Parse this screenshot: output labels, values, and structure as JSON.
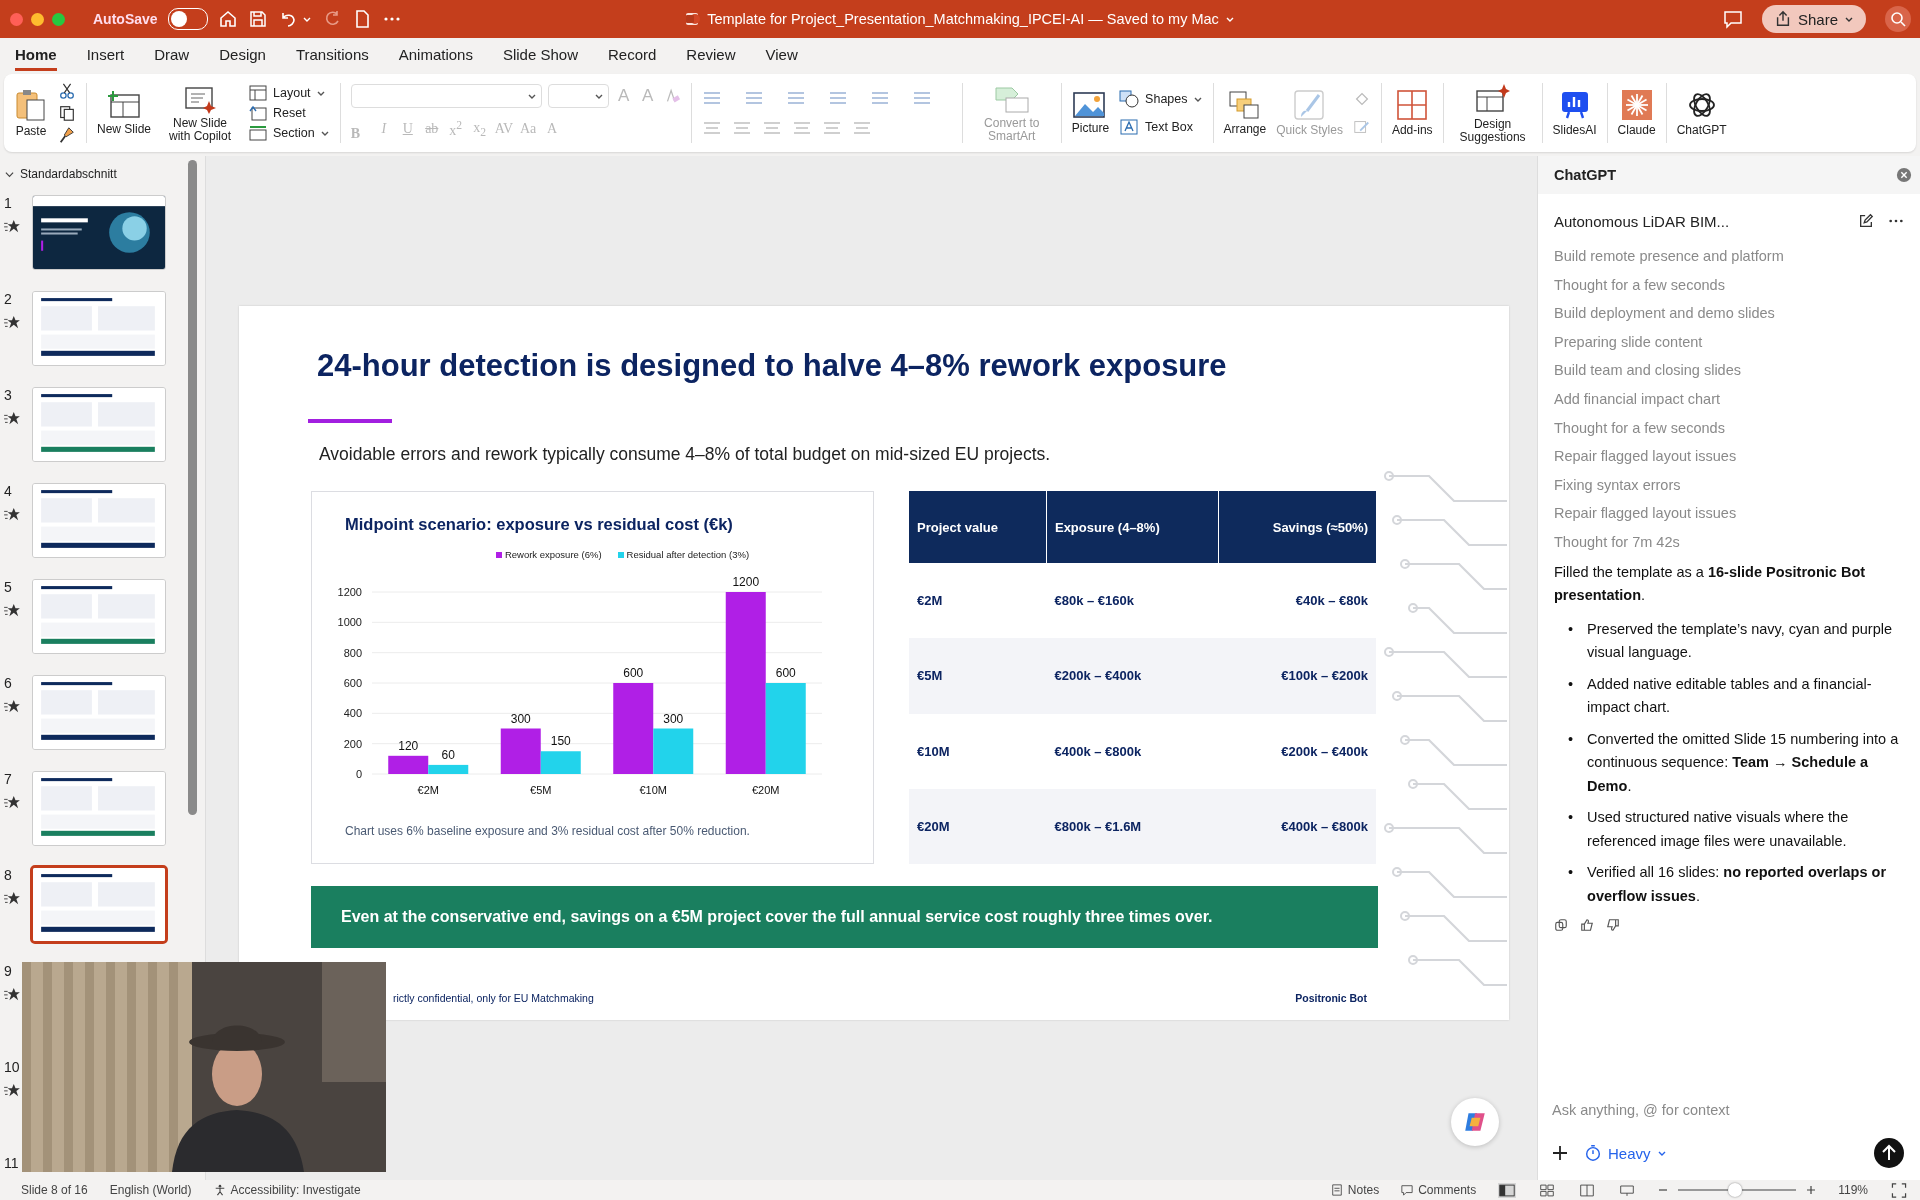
{
  "title_bar": {
    "autosave_label": "AutoSave",
    "autosave_on": false,
    "document_title": "Template for Project_Presentation_Matchmaking_IPCEI-AI — Saved to my Mac",
    "share_label": "Share"
  },
  "ribbon_tabs": [
    {
      "label": "Home",
      "selected": true
    },
    {
      "label": "Insert",
      "selected": false
    },
    {
      "label": "Draw",
      "selected": false
    },
    {
      "label": "Design",
      "selected": false
    },
    {
      "label": "Transitions",
      "selected": false
    },
    {
      "label": "Animations",
      "selected": false
    },
    {
      "label": "Slide Show",
      "selected": false
    },
    {
      "label": "Record",
      "selected": false
    },
    {
      "label": "Review",
      "selected": false
    },
    {
      "label": "View",
      "selected": false
    }
  ],
  "ribbon": {
    "paste": "Paste",
    "new_slide": "New Slide",
    "new_slide_copilot": "New Slide with Copilot",
    "layout": "Layout",
    "reset": "Reset",
    "section": "Section",
    "font_grow": [
      {
        "label": "A",
        "disabled": true
      },
      {
        "label": "A",
        "disabled": true
      }
    ],
    "font_format": [
      {
        "label": "B",
        "kind": "bold",
        "disabled": true
      },
      {
        "label": "I",
        "kind": "italic",
        "disabled": true
      },
      {
        "label": "U",
        "kind": "underline",
        "disabled": true
      },
      {
        "label": "ab",
        "kind": "strike",
        "disabled": true
      },
      {
        "label": "x$^{2}$",
        "kind": "plain",
        "disabled": true
      },
      {
        "label": "x$_{2}$",
        "kind": "plain",
        "disabled": true
      },
      {
        "label": "AV",
        "kind": "plain",
        "disabled": true
      },
      {
        "label": "Aa",
        "kind": "plain",
        "disabled": true
      },
      {
        "label": "A",
        "kind": "plain",
        "disabled": true
      }
    ],
    "convert_smartart": {
      "label": "Convert to SmartArt",
      "disabled": true
    },
    "picture": "Picture",
    "shapes": "Shapes",
    "text_box": "Text Box",
    "arrange": "Arrange",
    "quick_styles": {
      "label": "Quick Styles",
      "disabled": true
    },
    "add_ins": "Add-ins",
    "design_suggestions": "Design Suggestions",
    "slidesai": "SlidesAI",
    "claude": "Claude",
    "chatgpt": "ChatGPT"
  },
  "slide_panel": {
    "section_label": "Standardabschnitt",
    "slides": [
      {
        "number": "1",
        "selected": false,
        "kind": "dark"
      },
      {
        "number": "2",
        "selected": false,
        "kind": "light"
      },
      {
        "number": "3",
        "selected": false,
        "kind": "light"
      },
      {
        "number": "4",
        "selected": false,
        "kind": "light"
      },
      {
        "number": "5",
        "selected": false,
        "kind": "light"
      },
      {
        "number": "6",
        "selected": false,
        "kind": "light"
      },
      {
        "number": "7",
        "selected": false,
        "kind": "light"
      },
      {
        "number": "8",
        "selected": true,
        "kind": "light"
      }
    ],
    "covered_slides": [
      {
        "number": "9",
        "kind": "number_and_star"
      },
      {
        "number": "10",
        "kind": "number_and_star"
      },
      {
        "number": "11",
        "kind": "number_only"
      }
    ]
  },
  "slide": {
    "title": "24-hour detection is designed to halve 4–8% rework exposure",
    "subtitle": "Avoidable errors and rework typically consume 4–8% of total budget on mid-sized EU projects.",
    "chart_data": {
      "type": "bar",
      "title": "Midpoint scenario: exposure vs residual cost (€k)",
      "categories": [
        "€2M",
        "€5M",
        "€10M",
        "€20M"
      ],
      "series": [
        {
          "name": "Rework exposure (6%)",
          "color": "#b01fe6",
          "values": [
            120,
            300,
            600,
            1200
          ]
        },
        {
          "name": "Residual after detection (3%)",
          "color": "#22d3eb",
          "values": [
            60,
            150,
            300,
            600
          ]
        }
      ],
      "ylim": [
        0,
        1200
      ],
      "yticks": [
        0,
        200,
        400,
        600,
        800,
        1000,
        1200
      ],
      "grid": true,
      "data_labels": true
    },
    "chart_note": "Chart uses 6% baseline exposure and 3% residual cost after 50% reduction.",
    "table": {
      "columns": [
        "Project value",
        "Exposure (4–8%)",
        "Savings (≈50%)"
      ],
      "rows": [
        [
          "€2M",
          "€80k – €160k",
          "€40k – €80k"
        ],
        [
          "€5M",
          "€200k – €400k",
          "€100k – €200k"
        ],
        [
          "€10M",
          "€400k – €800k",
          "€200k – €400k"
        ],
        [
          "€20M",
          "€800k – €1.6M",
          "€400k – €800k"
        ]
      ]
    },
    "banner": "Even at the conservative end, savings on a €5M project cover the full annual service cost roughly three times over.",
    "footer_left": "rictly confidential, only for EU Matchmaking",
    "footer_right": "Positronic Bot"
  },
  "chat_panel": {
    "title": "ChatGPT",
    "conversation_title": "Autonomous LiDAR BIM...",
    "steps": [
      "Build remote presence and platform",
      "Thought for a few seconds",
      "Build deployment and demo slides",
      "Preparing slide content",
      "Build team and closing slides",
      "Add financial impact chart",
      "Thought for a few seconds",
      "Repair flagged layout issues",
      "Fixing syntax errors",
      "Repair flagged layout issues",
      "Thought for 7m 42s"
    ],
    "summary": "Filled the template as a **16-slide Positronic Bot presentation**.",
    "bullet_marker": "•",
    "bullets": [
      "Preserved the template’s navy, cyan and purple visual language.",
      "Added native editable tables and a financial-impact chart.",
      "Converted the omitted Slide 15 numbering into a continuous sequence: **Team → Schedule a Demo**.",
      "Used structured native visuals where the referenced image files were unavailable.",
      "Verified all 16 slides: **no reported overlaps or overflow issues**."
    ],
    "input_placeholder": "Ask anything, @ for context",
    "mode": "Heavy"
  },
  "status_bar": {
    "slide_counter": "Slide 8 of 16",
    "language": "English (World)",
    "accessibility": "Accessibility: Investigate",
    "notes": "Notes",
    "comments": "Comments",
    "zoom": {
      "level": 0.48
    },
    "zoom_value": "119%"
  }
}
